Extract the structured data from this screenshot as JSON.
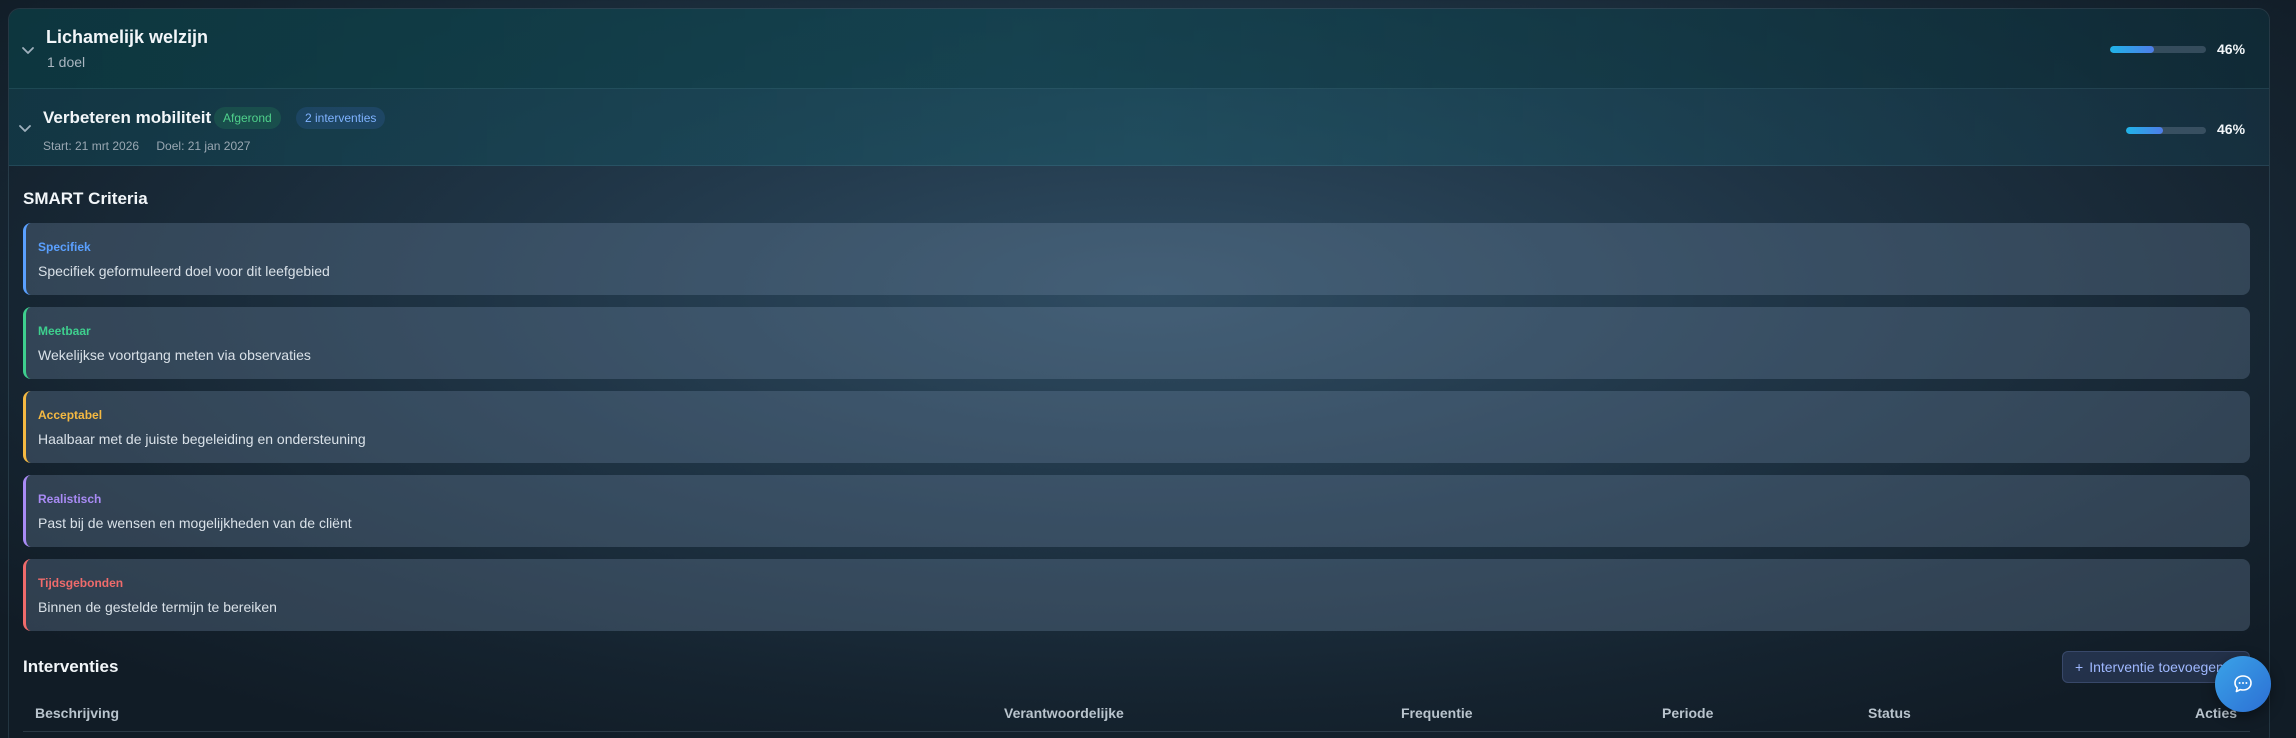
{
  "area": {
    "title": "Lichamelijk welzijn",
    "subtitle": "1 doel",
    "progress_percent": 46,
    "progress_label": "46%"
  },
  "goal": {
    "title": "Verbeteren mobiliteit",
    "status_badge": "Afgerond",
    "interventions_badge": "2 interventies",
    "start": "Start: 21 mrt 2026",
    "target": "Doel: 21 jan 2027",
    "progress_percent": 46,
    "progress_label": "46%"
  },
  "smart": {
    "title": "SMART Criteria",
    "items": [
      {
        "label": "Specifiek",
        "text": "Specifiek geformuleerd doel voor dit leefgebied",
        "color": "#5aa0ff"
      },
      {
        "label": "Meetbaar",
        "text": "Wekelijkse voortgang meten via observaties",
        "color": "#3ecf8e"
      },
      {
        "label": "Acceptabel",
        "text": "Haalbaar met de juiste begeleiding en ondersteuning",
        "color": "#f5b942"
      },
      {
        "label": "Realistisch",
        "text": "Past bij de wensen en mogelijkheden van de cliënt",
        "color": "#a98bf5"
      },
      {
        "label": "Tijdsgebonden",
        "text": "Binnen de gestelde termijn te bereiken",
        "color": "#ef6b6b"
      }
    ]
  },
  "interventions": {
    "title": "Interventies",
    "add_label": "Interventie toevoegen",
    "columns": [
      "Beschrijving",
      "Verantwoordelijke",
      "Frequentie",
      "Periode",
      "Status",
      "Acties"
    ]
  },
  "colors": {
    "accent": "#2c6fd4",
    "progress": "#1fb4e8"
  },
  "icons": {
    "expand": "chevron-down-icon",
    "add": "plus-icon",
    "chat": "chat-bubble-icon"
  }
}
